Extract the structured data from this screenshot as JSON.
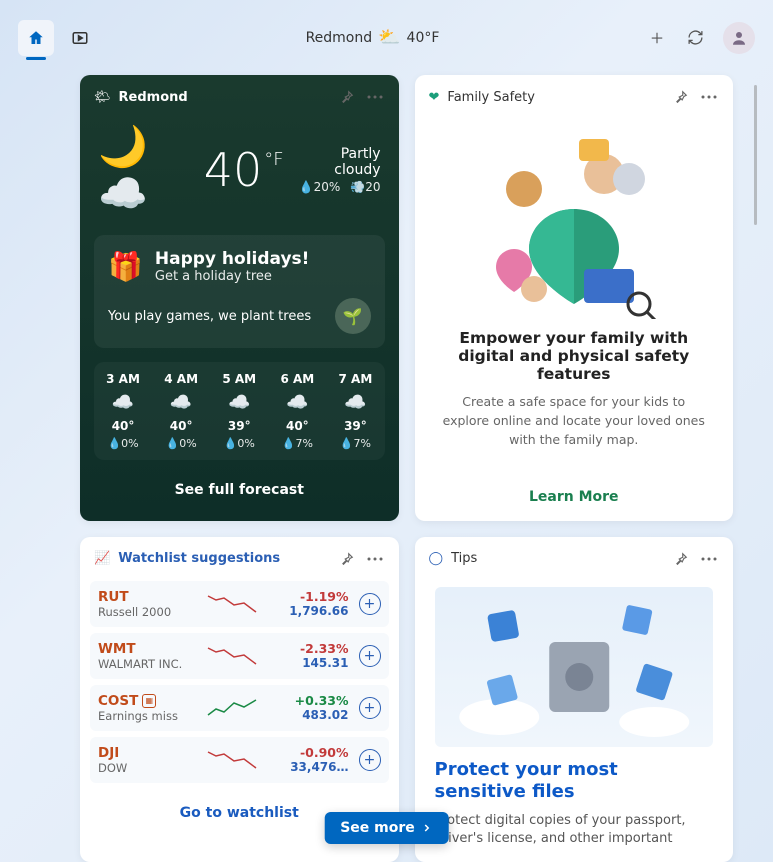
{
  "topbar": {
    "location": "Redmond",
    "temp": "40°F"
  },
  "weather": {
    "title": "Redmond",
    "temp": "40",
    "unit": "°F",
    "condition": "Partly cloudy",
    "precip": "20%",
    "wind": "20",
    "promo_title": "Happy holidays!",
    "promo_sub": "Get a holiday tree",
    "promo_line": "You play games, we plant trees",
    "hourly": [
      {
        "t": "3 AM",
        "temp": "40°",
        "pp": "0%"
      },
      {
        "t": "4 AM",
        "temp": "40°",
        "pp": "0%"
      },
      {
        "t": "5 AM",
        "temp": "39°",
        "pp": "0%"
      },
      {
        "t": "6 AM",
        "temp": "40°",
        "pp": "7%"
      },
      {
        "t": "7 AM",
        "temp": "39°",
        "pp": "7%"
      }
    ],
    "see_more": "See full forecast"
  },
  "family": {
    "title": "Family Safety",
    "headline": "Empower your family with digital and physical safety features",
    "desc": "Create a safe space for your kids to explore online and locate your loved ones with the family map.",
    "cta": "Learn More"
  },
  "watchlist": {
    "title": "Watchlist suggestions",
    "items": [
      {
        "tk": "RUT",
        "nm": "Russell 2000",
        "pct": "-1.19%",
        "pr": "1,796.66",
        "dir": "neg"
      },
      {
        "tk": "WMT",
        "nm": "WALMART INC.",
        "pct": "-2.33%",
        "pr": "145.31",
        "dir": "neg"
      },
      {
        "tk": "COST",
        "nm": "Earnings miss",
        "pct": "+0.33%",
        "pr": "483.02",
        "dir": "pos",
        "badge": true
      },
      {
        "tk": "DJI",
        "nm": "DOW",
        "pct": "-0.90%",
        "pr": "33,476…",
        "dir": "neg"
      }
    ],
    "cta": "Go to watchlist"
  },
  "tips": {
    "title": "Tips",
    "headline": "Protect your most sensitive files",
    "desc": "Protect digital copies of your passport, driver's license, and other important"
  },
  "see_more": "See more"
}
